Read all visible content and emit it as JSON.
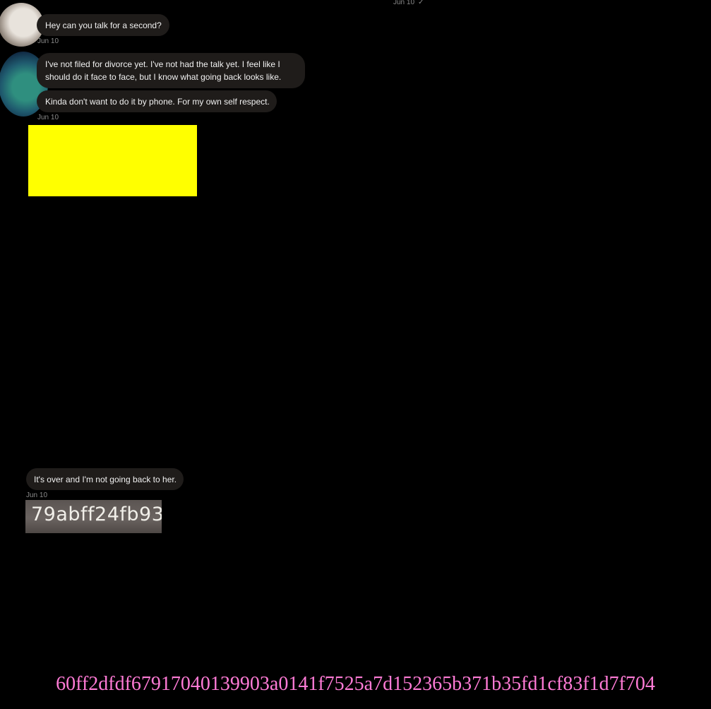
{
  "top_status": {
    "date": "Jun 10",
    "read_mark": "✓"
  },
  "messages": [
    {
      "text": "Hey can you talk for a second?",
      "timestamp": "Jun 10"
    },
    {
      "text": "I've not filed for divorce yet. I've not had the talk yet. I feel like I should do it face to face, but I know what going back looks like."
    },
    {
      "text": "Kinda don't want to do it by phone. For my own self respect.",
      "timestamp": "Jun 10"
    },
    {
      "text": "It's over and I'm not going back to her.",
      "timestamp": "Jun 10"
    }
  ],
  "media": [
    {
      "type": "image",
      "fill": "#ffff00"
    },
    {
      "type": "image",
      "visible_text": "79abff24fb93"
    }
  ],
  "footer": {
    "hash": "60ff2dfdf67917040139903a0141f7525a7d152365b371b35fd1cf83f1d7f704"
  },
  "colors": {
    "background": "#000000",
    "bubble": "#1f1c1a",
    "timestamp": "#8a8a8a",
    "hash": "#ff7bd6"
  },
  "icons": [
    "avatar-cat-icon",
    "avatar-person-icon",
    "read-check-icon"
  ]
}
